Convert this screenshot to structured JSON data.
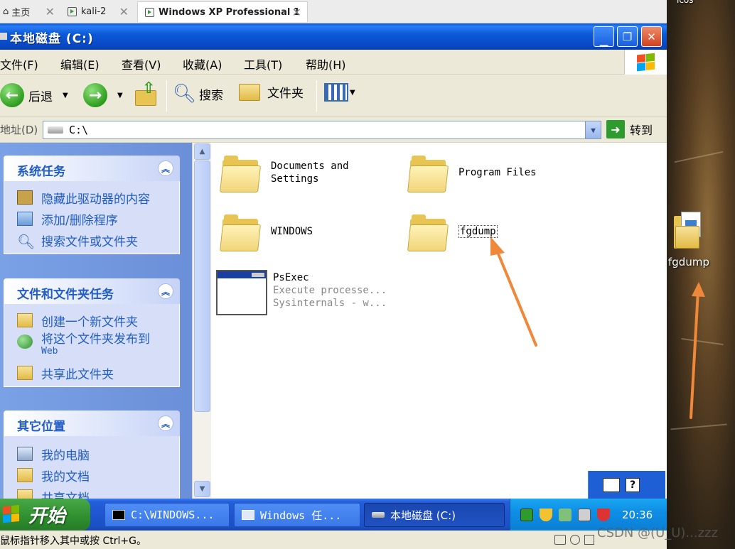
{
  "host_tabs": [
    {
      "label": "主页"
    },
    {
      "label": "kali-2"
    },
    {
      "label": "Windows XP Professional 1"
    }
  ],
  "window": {
    "title": "本地磁盘 (C:)"
  },
  "menu": [
    "文件(F)",
    "编辑(E)",
    "查看(V)",
    "收藏(A)",
    "工具(T)",
    "帮助(H)"
  ],
  "toolbar": {
    "back": "后退",
    "search": "搜索",
    "folders": "文件夹"
  },
  "address": {
    "label": "地址(D)",
    "value": "C:\\",
    "go": "转到"
  },
  "left_panels": [
    {
      "title": "系统任务",
      "items": [
        "隐藏此驱动器的内容",
        "添加/删除程序",
        "搜索文件或文件夹"
      ]
    },
    {
      "title": "文件和文件夹任务",
      "items": [
        "创建一个新文件夹",
        "将这个文件夹发布到",
        "Web",
        "共享此文件夹"
      ]
    },
    {
      "title": "其它位置",
      "items": [
        "我的电脑",
        "我的文档",
        "共享文档"
      ]
    }
  ],
  "files": [
    {
      "name_line1": "Documents and",
      "name_line2": "Settings",
      "type": "folder"
    },
    {
      "name_line1": "Program Files",
      "type": "folder"
    },
    {
      "name_line1": "WINDOWS",
      "type": "folder"
    },
    {
      "name_line1": "fgdump",
      "type": "folder",
      "selected": true
    },
    {
      "name_line1": "PsExec",
      "desc1": "Execute processe...",
      "desc2": "Sysinternals - w...",
      "type": "app"
    }
  ],
  "taskbar": {
    "start": "开始",
    "buttons": [
      "C:\\WINDOWS...",
      "Windows 任...",
      "本地磁盘 (C:)"
    ],
    "clock": "20:36"
  },
  "statusbar": {
    "text": "鼠标指针移入其中或按 Ctrl+G。"
  },
  "desktop": {
    "icon_label": "fgdump",
    "top_label": "icos"
  },
  "watermark": "CSDN @(U_U)...zzz",
  "colors": {
    "xp_blue": "#0b5ad8",
    "task_link": "#215dc6",
    "arrow": "#f0883a"
  }
}
